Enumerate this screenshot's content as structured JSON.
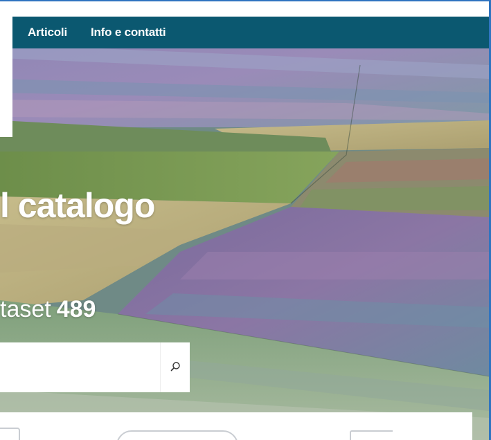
{
  "nav": {
    "items": [
      {
        "label": "Articoli"
      },
      {
        "label": "Info e contatti"
      }
    ]
  },
  "hero": {
    "title": "l catalogo",
    "dataset_label": "taset",
    "dataset_count": "489"
  },
  "search": {
    "value": "",
    "placeholder": "",
    "icon": "search-icon"
  },
  "colors": {
    "nav_background": "#0b5870",
    "frame": "#2f74c0",
    "text_on_hero": "#ffffff"
  }
}
